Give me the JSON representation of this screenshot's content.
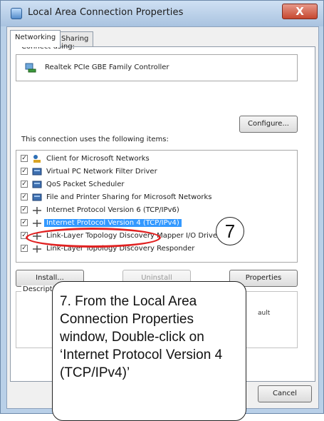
{
  "window": {
    "title": "Local Area Connection Properties",
    "close_label": "X"
  },
  "tabs": [
    {
      "label": "Networking",
      "active": true
    },
    {
      "label": "Sharing",
      "active": false
    }
  ],
  "connect_using": {
    "label": "Connect using:",
    "adapter": "Realtek PCIe GBE Family Controller",
    "adapter_icon": "network-adapter-icon"
  },
  "buttons": {
    "configure": "Configure...",
    "install": "Install...",
    "uninstall": "Uninstall",
    "properties": "Properties",
    "cancel": "Cancel"
  },
  "items_label": "This connection uses the following items:",
  "items": [
    {
      "label": "Client for Microsoft Networks",
      "checked": true,
      "icon": "network-client-icon"
    },
    {
      "label": "Virtual PC Network Filter Driver",
      "checked": true,
      "icon": "service-icon"
    },
    {
      "label": "QoS Packet Scheduler",
      "checked": true,
      "icon": "service-icon"
    },
    {
      "label": "File and Printer Sharing for Microsoft Networks",
      "checked": true,
      "icon": "service-icon"
    },
    {
      "label": "Internet Protocol Version 6 (TCP/IPv6)",
      "checked": true,
      "icon": "protocol-icon"
    },
    {
      "label": "Internet Protocol Version 4 (TCP/IPv4)",
      "checked": true,
      "icon": "protocol-icon",
      "selected": true
    },
    {
      "label": "Link-Layer Topology Discovery Mapper I/O Driver",
      "checked": true,
      "icon": "protocol-icon"
    },
    {
      "label": "Link-Layer Topology Discovery Responder",
      "checked": true,
      "icon": "protocol-icon"
    }
  ],
  "description": {
    "label": "Description",
    "tail": "ault"
  },
  "annotation": {
    "step_number": "7",
    "instruction": "7.  From the Local Area Connection Properties window, Double-click on ‘Internet Protocol Version 4 (TCP/IPv4)’",
    "highlight_color": "#e02121"
  },
  "colors": {
    "selection": "#3399ff",
    "titlebar": "#b9d0e8",
    "close_button": "#c64730"
  }
}
